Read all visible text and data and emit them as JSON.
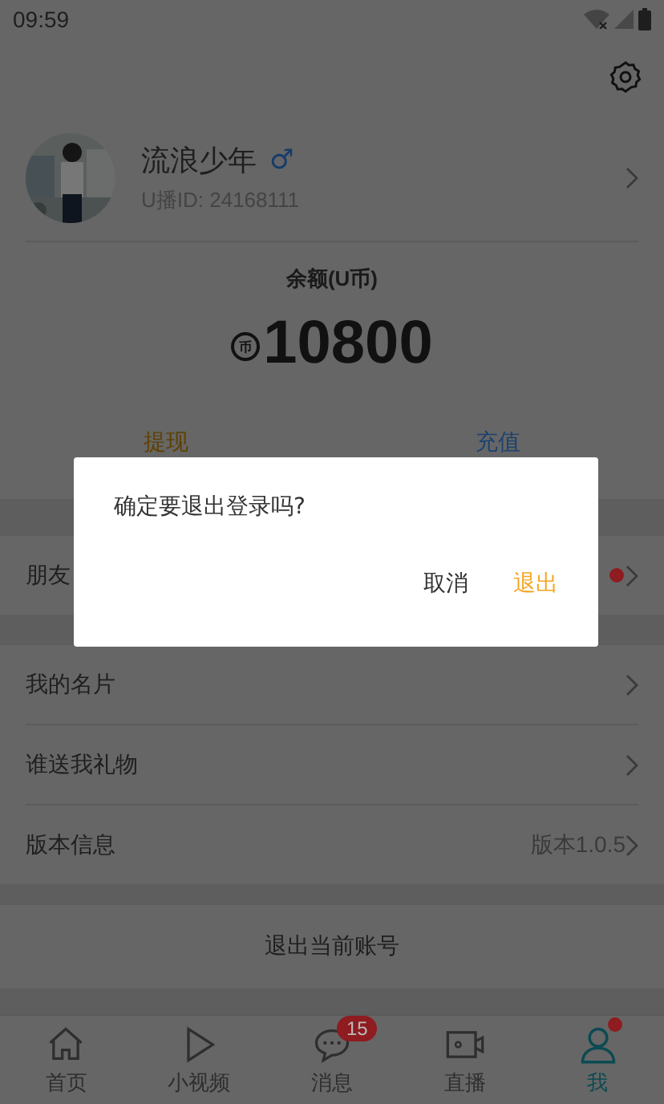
{
  "status_bar": {
    "time": "09:59"
  },
  "profile": {
    "name": "流浪少年",
    "gender_symbol": "♂",
    "id_text": "U播ID: 24168111"
  },
  "balance": {
    "label": "余额(U币)",
    "coin_symbol": "币",
    "amount": "10800"
  },
  "actions": [
    {
      "label": "提现",
      "color": "#5e4000"
    },
    {
      "label": "充值",
      "color": "#1c4270"
    }
  ],
  "menu_groups": [
    [
      {
        "label": "朋友",
        "dot": true
      }
    ],
    [
      {
        "label": "我的名片",
        "dot": false
      },
      {
        "label": "谁送我礼物",
        "dot": false
      },
      {
        "label": "版本信息",
        "dot": false,
        "value": "版本1.0.5"
      }
    ]
  ],
  "logout_button": "退出当前账号",
  "tabs": [
    {
      "kind": "home",
      "label": "首页",
      "selected": false,
      "dot": false
    },
    {
      "kind": "video",
      "label": "小视频",
      "selected": false,
      "dot": false
    },
    {
      "kind": "message",
      "label": "消息",
      "selected": false,
      "dot": false,
      "badge": "15"
    },
    {
      "kind": "live",
      "label": "直播",
      "selected": false,
      "dot": false
    },
    {
      "kind": "me",
      "label": "我",
      "selected": true,
      "dot": true
    }
  ],
  "dialog": {
    "message": "确定要退出登录吗?",
    "buttons": [
      {
        "kind": "cancel",
        "label": "取消"
      },
      {
        "kind": "confirm",
        "label": "退出"
      }
    ]
  }
}
